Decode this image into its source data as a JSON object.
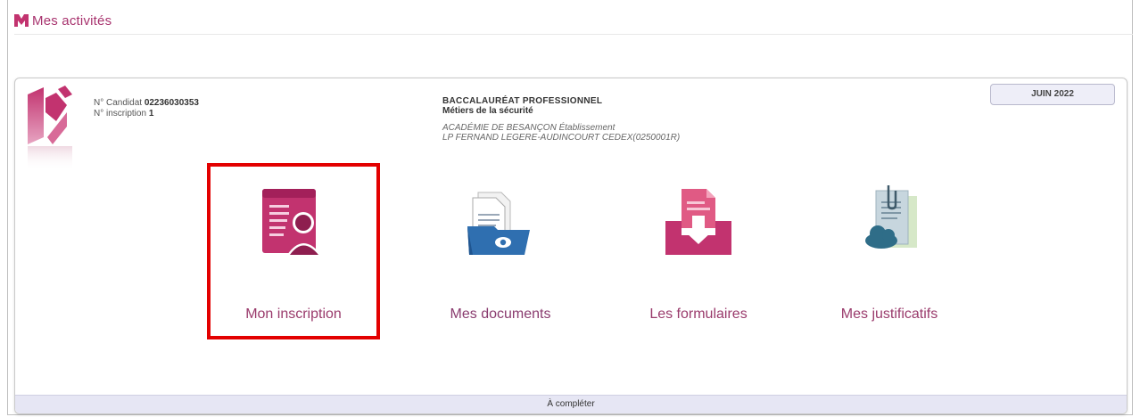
{
  "header": {
    "title": "Mes activités",
    "logo_icon": "m-logo-icon"
  },
  "candidate": {
    "candidate_label": "N° Candidat",
    "candidate_number": "02236030353",
    "inscription_label": "N° inscription",
    "inscription_number": "1"
  },
  "exam": {
    "diploma": "BACCALAURÉAT PROFESSIONNEL",
    "specialty": "Métiers de la sécurité",
    "academy_line": "ACADÉMIE DE BESANÇON Établissement",
    "establishment": "LP FERNAND LEGERE-AUDINCOURT CEDEX(0250001R)"
  },
  "session": {
    "label": "JUIN 2022"
  },
  "tiles": [
    {
      "label": "Mon inscription",
      "icon": "registration-form-icon",
      "highlighted": true
    },
    {
      "label": "Mes documents",
      "icon": "documents-folder-icon",
      "highlighted": false
    },
    {
      "label": "Les formulaires",
      "icon": "forms-download-icon",
      "highlighted": false
    },
    {
      "label": "Mes justificatifs",
      "icon": "supporting-docs-icon",
      "highlighted": false
    }
  ],
  "status": {
    "text": "À compléter"
  },
  "colors": {
    "brand_magenta": "#c2336f",
    "blue": "#2f6fb0",
    "highlight": "#e30000",
    "status_bar": "#e6e6f4"
  }
}
